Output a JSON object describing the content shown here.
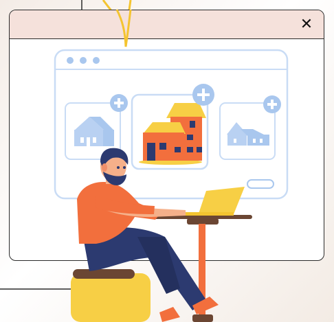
{
  "dialog": {
    "close_label": "✕"
  },
  "colors": {
    "header_bg": "#f5e1db",
    "border": "#2a2a2a",
    "accent_orange": "#f26f3d",
    "accent_yellow": "#f7cf45",
    "card_blue": "#a9c7ee",
    "window_blue": "#c9dcf5"
  },
  "illustration": {
    "icons": [
      "browser-window-icon",
      "house-icon",
      "plus-icon",
      "person-at-laptop"
    ]
  }
}
